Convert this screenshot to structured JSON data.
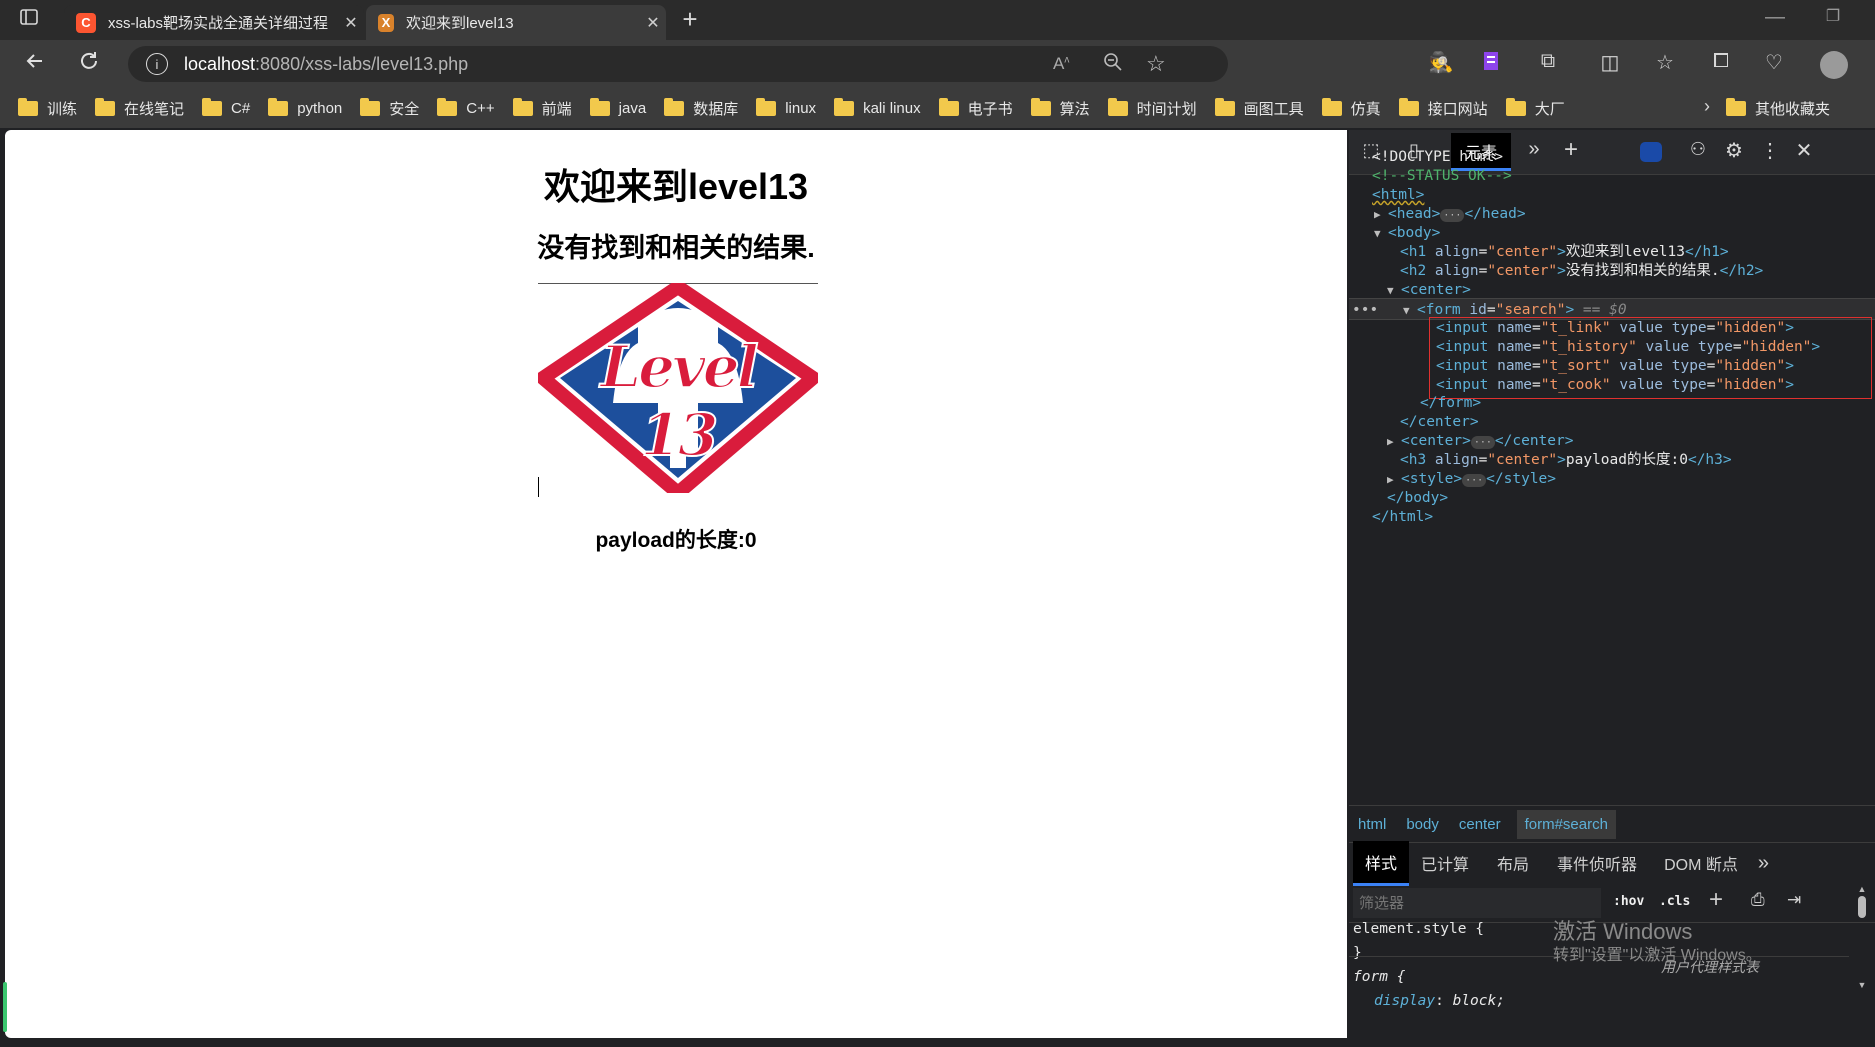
{
  "tabs": [
    {
      "title": "xss-labs靶场实战全通关详细过程",
      "favicon": "C"
    },
    {
      "title": "欢迎来到level13",
      "favicon": "X"
    }
  ],
  "address": {
    "host": "localhost",
    "path": ":8080/xss-labs/level13.php"
  },
  "bookmarks": [
    "训练",
    "在线笔记",
    "C#",
    "python",
    "安全",
    "C++",
    "前端",
    "java",
    "数据库",
    "linux",
    "kali linux",
    "电子书",
    "算法",
    "时间计划",
    "画图工具",
    "仿真",
    "接口网站",
    "大厂"
  ],
  "bookmarks_other": "其他收藏夹",
  "page": {
    "h1": "欢迎来到level13",
    "h2": "没有找到和相关的结果.",
    "logo_text": "Level 13",
    "h3": "payload的长度:0"
  },
  "devtools": {
    "tab_elements": "元素",
    "dom": {
      "doctype": "<!DOCTYPE html>",
      "comment": "<!--STATUS OK-->",
      "html_open": "<html>",
      "head": "<head>",
      "head_close": "</head>",
      "body": "<body>",
      "h1_open": "<h1 ",
      "h1_attr": "align",
      "h1_val": "\"center\"",
      "h1_text": "欢迎来到level13",
      "h1_close": "</h1>",
      "h2_open": "<h2 ",
      "h2_attr": "align",
      "h2_val": "\"center\"",
      "h2_text": "没有找到和相关的结果.",
      "h2_close": "</h2>",
      "center_open": "<center>",
      "form_open": "<form ",
      "form_attr": "id",
      "form_val": "\"search\"",
      "form_end": ">",
      "selected_marker": "== $0",
      "inputs": [
        {
          "name": "\"t_link\"",
          "type": "\"hidden\""
        },
        {
          "name": "\"t_history\"",
          "type": "\"hidden\""
        },
        {
          "name": "\"t_sort\"",
          "type": "\"hidden\""
        },
        {
          "name": "\"t_cook\"",
          "type": "\"hidden\""
        }
      ],
      "input_tag": "<input ",
      "attr_name": "name",
      "attr_value": "value",
      "attr_type": "type",
      "form_close": "</form>",
      "center_close": "</center>",
      "center2_open": "<center>",
      "center2_close": "</center>",
      "h3_open": "<h3 ",
      "h3_attr": "align",
      "h3_val": "\"center\"",
      "h3_text": "payload的长度:0",
      "h3_close": "</h3>",
      "style_open": "<style>",
      "style_close": "</style>",
      "body_close": "</body>",
      "html_close": "</html>"
    },
    "breadcrumbs": [
      "html",
      "body",
      "center",
      "form#search"
    ],
    "style_tabs": [
      "样式",
      "已计算",
      "布局",
      "事件侦听器",
      "DOM 断点"
    ],
    "filter_placeholder": "筛选器",
    "hov": ":hov",
    "cls": ".cls",
    "rule1_selector": "element.style {",
    "rule1_close": "}",
    "rule2_selector": "form {",
    "rule2_source": "用户代理样式表",
    "rule2_prop": "display",
    "rule2_val": "block;",
    "watermark_title": "激活 Windows",
    "watermark_sub": "转到\"设置\"以激活 Windows。"
  },
  "colors": {
    "accent": "#3b82f6",
    "highlight_box": "#e0312f",
    "logo_red": "#d91c3c",
    "logo_blue": "#1d4f9c"
  }
}
